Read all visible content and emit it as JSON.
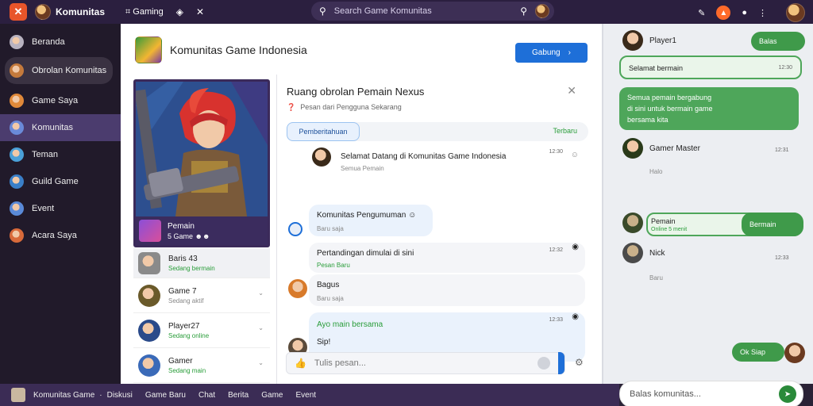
{
  "topbar": {
    "brand": "Komunitas",
    "nav_label": "Gaming",
    "search_placeholder": "Search Game Komunitas",
    "icons": [
      "logo-icon",
      "gamepad-icon",
      "shield-icon",
      "close-icon",
      "search-icon",
      "bell-icon",
      "fire-icon",
      "info-icon",
      "more-icon"
    ]
  },
  "sidebar": {
    "items": [
      {
        "label": "Beranda",
        "color": "#b8b2c0"
      },
      {
        "label": "Obrolan Komunitas",
        "color": "#c47a3c"
      },
      {
        "label": "Game Saya",
        "color": "#e0893a"
      },
      {
        "label": "Komunitas",
        "color": "#6a8ad8"
      },
      {
        "label": "Teman",
        "color": "#4aa0d8"
      },
      {
        "label": "Guild Game",
        "color": "#3a7fc8"
      },
      {
        "label": "Event",
        "color": "#5a8ad8"
      },
      {
        "label": "Acara Saya",
        "color": "#d86a3a"
      }
    ]
  },
  "main": {
    "title": "Komunitas Game Indonesia",
    "join_label": "Gabung"
  },
  "hero": {
    "name": "Pemain",
    "meta": "5 Game"
  },
  "players": [
    {
      "name": "Baris 43",
      "status": "Sedang bermain",
      "status_green": true,
      "color": "#8a8a8a"
    },
    {
      "name": "Game 7",
      "status": "Sedang aktif",
      "status_green": false,
      "color": "#6a5a2a"
    },
    {
      "name": "Player27",
      "status": "Sedang online",
      "status_green": true,
      "color": "#2a4a8a"
    },
    {
      "name": "Gamer",
      "status": "Sedang main",
      "status_green": true,
      "color": "#3a6ab8"
    }
  ],
  "chat": {
    "title": "Ruang obrolan Pemain Nexus",
    "subtitle": "Pesan dari Pengguna Sekarang",
    "tab_active": "Pemberitahuan",
    "tab_right": "Terbaru",
    "messages": [
      {
        "text": "Selamat Datang di Komunitas Game Indonesia",
        "sub": "Semua Pemain",
        "time": "12:30",
        "green": false
      },
      {
        "text": "Komunitas Pengumuman",
        "sub": "Baru saja",
        "time": "",
        "green": false
      },
      {
        "text": "Pertandingan dimulai di sini",
        "sub": "Pesan Baru",
        "time": "12:32",
        "green": false
      },
      {
        "text": "Bagus",
        "sub": "Baru saja",
        "time": "",
        "green": false
      },
      {
        "text": "Ayo main bersama",
        "sub": "Sip!",
        "time": "12:33",
        "green": true
      }
    ],
    "composer_placeholder": "Tulis pesan..."
  },
  "right_panel": {
    "top_user": "Player1",
    "top_pill": "Balas",
    "pill_2": "Selamat bermain",
    "pill_2_time": "12:30",
    "big_text_1": "Semua pemain bergabung",
    "big_text_2": "di sini untuk bermain game",
    "big_text_3": "bersama kita",
    "user_2": "Gamer Master",
    "user_2_time": "12:31",
    "user_2_sub": "Halo",
    "user_3": "Pemain",
    "user_3_pill": "Bermain",
    "user_3_sub": "Online 5 menit",
    "user_4": "Nick",
    "user_4_time": "12:33",
    "user_4_sub": "Baru",
    "bottom_pill": "Ok Siap",
    "input_placeholder": "Balas komunitas..."
  },
  "bottombar": {
    "items": [
      "Komunitas Game",
      "Diskusi",
      "Game Baru",
      "Chat",
      "Berita",
      "Game",
      "Event"
    ]
  }
}
